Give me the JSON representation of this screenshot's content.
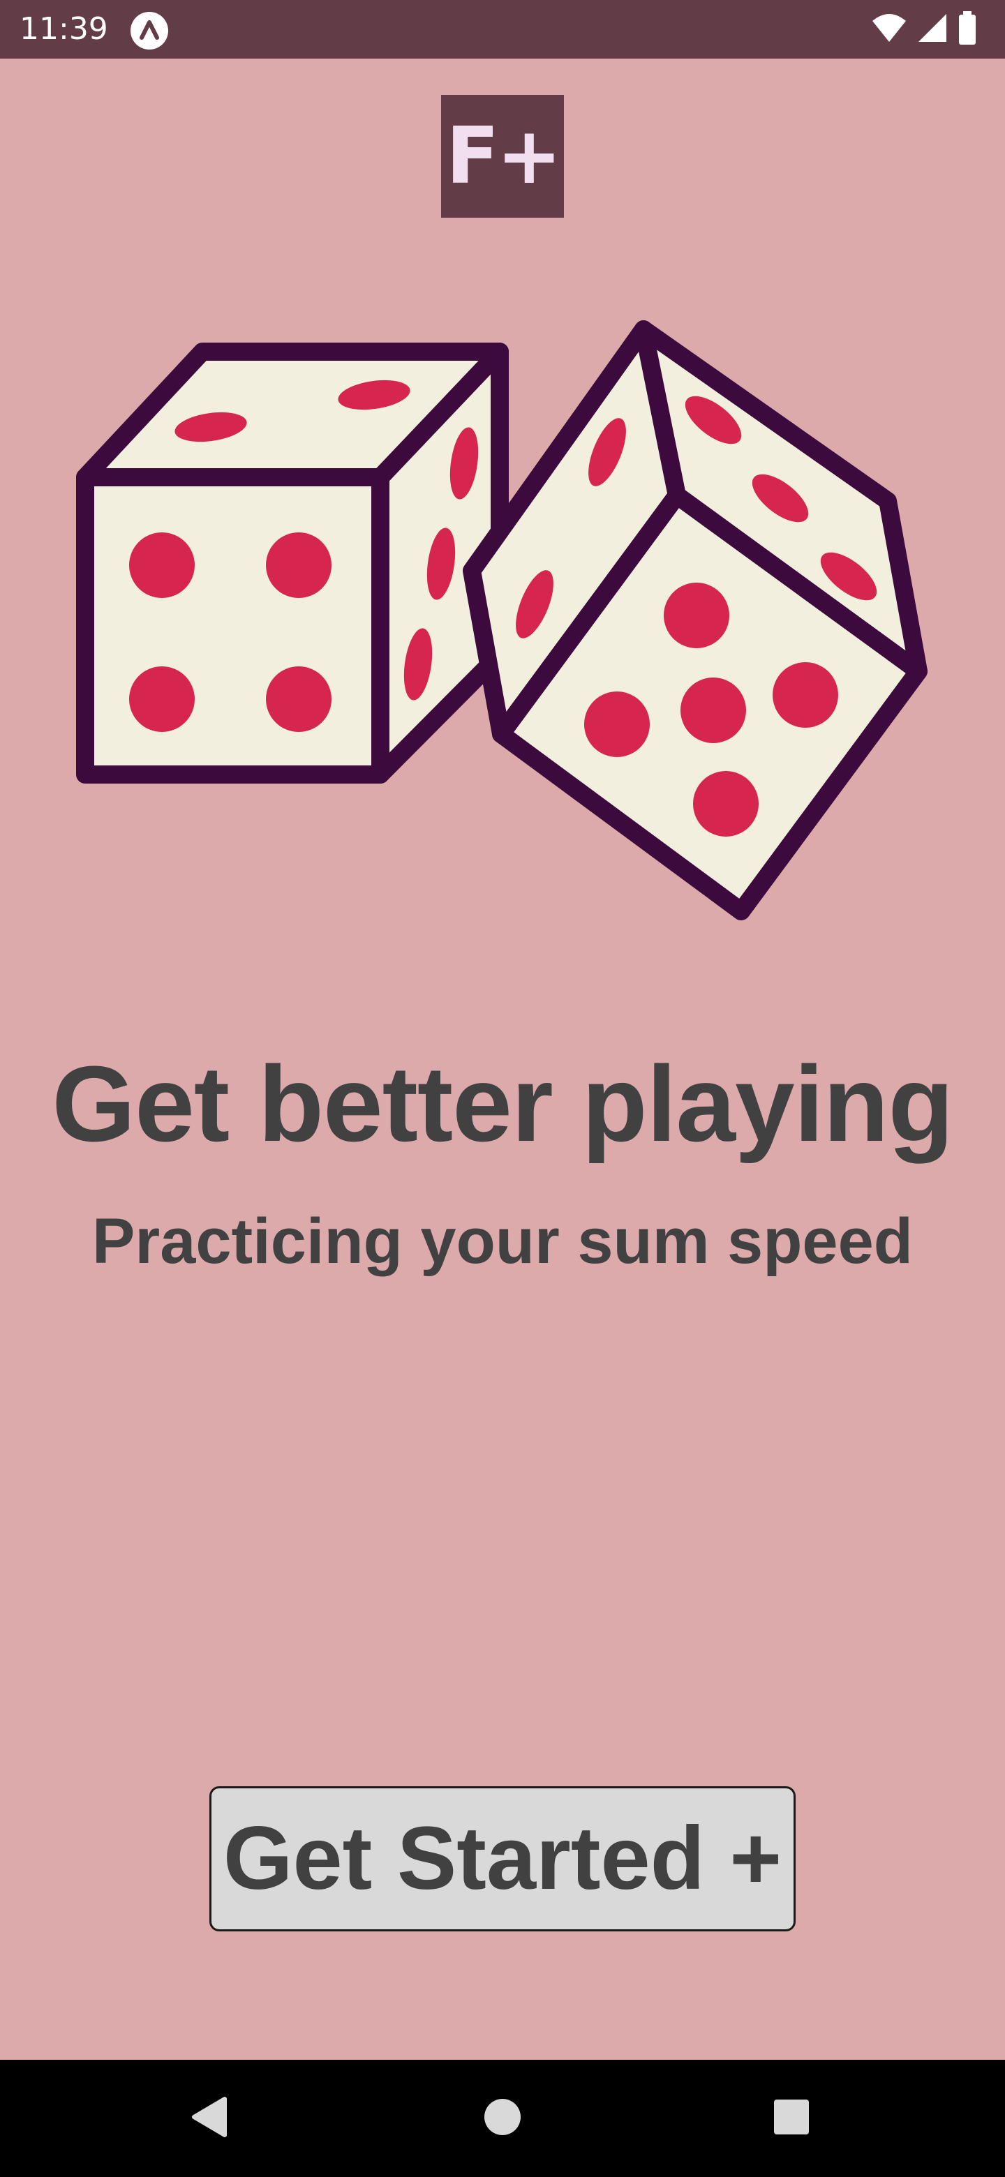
{
  "status_bar": {
    "time": "11:39",
    "app_icon": "a-letter-circle-icon",
    "icons": [
      "wifi-icon",
      "cellular-signal-icon",
      "battery-icon"
    ],
    "background": "#623c46"
  },
  "logo": {
    "text": "F+",
    "background": "#623c46",
    "color": "#f1dff0"
  },
  "illustration": {
    "name": "two-dice-illustration",
    "outline_color": "#3d0a3d",
    "face_color": "#f3efdf",
    "pip_color": "#d6254e"
  },
  "main": {
    "headline": "Get better playing",
    "subheadline": "Practicing your sum speed",
    "text_color": "#414141",
    "background": "#dcaaaa"
  },
  "cta": {
    "label": "Get Started +"
  },
  "nav_bar": {
    "buttons": [
      "back-icon",
      "home-icon",
      "recents-icon"
    ]
  }
}
